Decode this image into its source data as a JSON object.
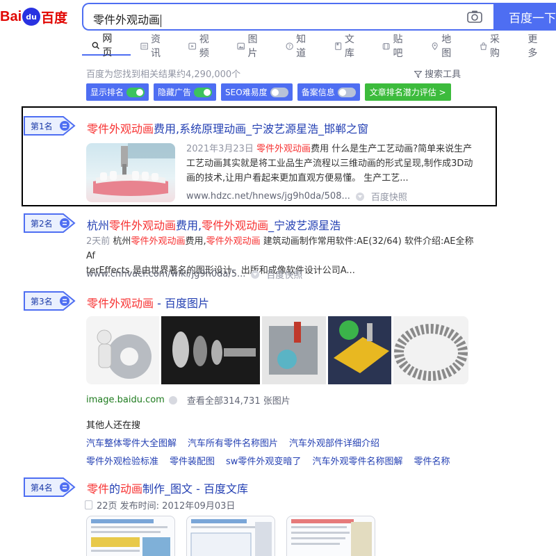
{
  "logo": {
    "part1": "Bai",
    "paw": "du",
    "part2": "百度"
  },
  "search": {
    "query": "零件外观动画",
    "button_label": "百度一下"
  },
  "tabs": [
    {
      "label": "网页",
      "icon": "search-icon"
    },
    {
      "label": "资讯",
      "icon": "news-icon"
    },
    {
      "label": "视频",
      "icon": "video-icon"
    },
    {
      "label": "图片",
      "icon": "image-icon"
    },
    {
      "label": "知道",
      "icon": "question-icon"
    },
    {
      "label": "文库",
      "icon": "doc-icon"
    },
    {
      "label": "贴吧",
      "icon": "tieba-icon"
    },
    {
      "label": "地图",
      "icon": "map-icon"
    },
    {
      "label": "采购",
      "icon": "purchase-icon"
    },
    {
      "label": "更多",
      "icon": ""
    }
  ],
  "result_count": "百度为您找到相关结果约4,290,000个",
  "search_tools": "搜索工具",
  "seo_pills": [
    {
      "label": "显示排名",
      "state": "on"
    },
    {
      "label": "隐藏广告",
      "state": "on"
    },
    {
      "label": "SEO难易度",
      "state": "off"
    },
    {
      "label": "备案信息",
      "state": "off"
    },
    {
      "label": "文章排名潜力评估 >",
      "state": "none"
    }
  ],
  "results": [
    {
      "rank": "第1名",
      "title_hl": "零件外观动画",
      "title_rest": "费用,系统原理动画_宁波艺源星浩_邯郸之窗",
      "date": "2021年3月23日",
      "snippet_hl": "零件外观动画",
      "snippet_line1": "费用 什么是生产工艺动画?简单来说生产",
      "snippet_line2": "工艺动画其实就是将工业品生产流程以三维动画的形式呈现,制作成3D动",
      "snippet_line3": "画的技术,让用户看起来更加直观方便易懂。 生产工艺...",
      "url": "www.hdzc.net/hnews/jg9h0da/508...",
      "snapshot": "百度快照"
    },
    {
      "rank": "第2名",
      "title_pre": "杭州",
      "title_hl1": "零件外观动画",
      "title_mid": "费用,",
      "title_hl2": "零件外观动画",
      "title_rest": "_宁波艺源星浩",
      "snippet_date": "2天前",
      "snippet_pre": "杭州",
      "snippet_hl1": "零件外观动画",
      "snippet_mid": "费用,",
      "snippet_hl2": "零件外观动画",
      "snippet_line1_rest": " 建筑动画制作常用软件:AE(32/64) 软件介绍:AE全称Af",
      "snippet_line2": "terEffects,是由世界著名的图形设计、出版和成像软件设计公司A...",
      "url": "www.cnhvacr.com/wiki/jg9h0da/5...",
      "snapshot": "百度快照"
    },
    {
      "rank": "第3名",
      "title_hl": "零件外观动画",
      "title_rest": " - 百度图片",
      "source": "image.baidu.com",
      "view_all": "查看全部314,731 张图片"
    },
    {
      "rank": "第4名",
      "title_hl1": "零件",
      "title_mid": "的",
      "title_hl2": "动画",
      "title_rest": "制作_图文 - 百度文库",
      "meta": "22页 发布时间: 2012年09月03日"
    }
  ],
  "also_search": {
    "title": "其他人还在搜",
    "row1": [
      "汽车整体零件大全图解",
      "汽车所有零件名称图片",
      "汽车外观部件详细介绍"
    ],
    "row2": [
      "零件外观检验标准",
      "零件装配图",
      "sw零件外观变暗了",
      "汽车外观零件名称图解",
      "零件名称"
    ]
  },
  "colors": {
    "accent": "#4e6ef2",
    "highlight": "#f73131",
    "title": "#2440b3",
    "badge_bg": "#eaf0fe"
  }
}
